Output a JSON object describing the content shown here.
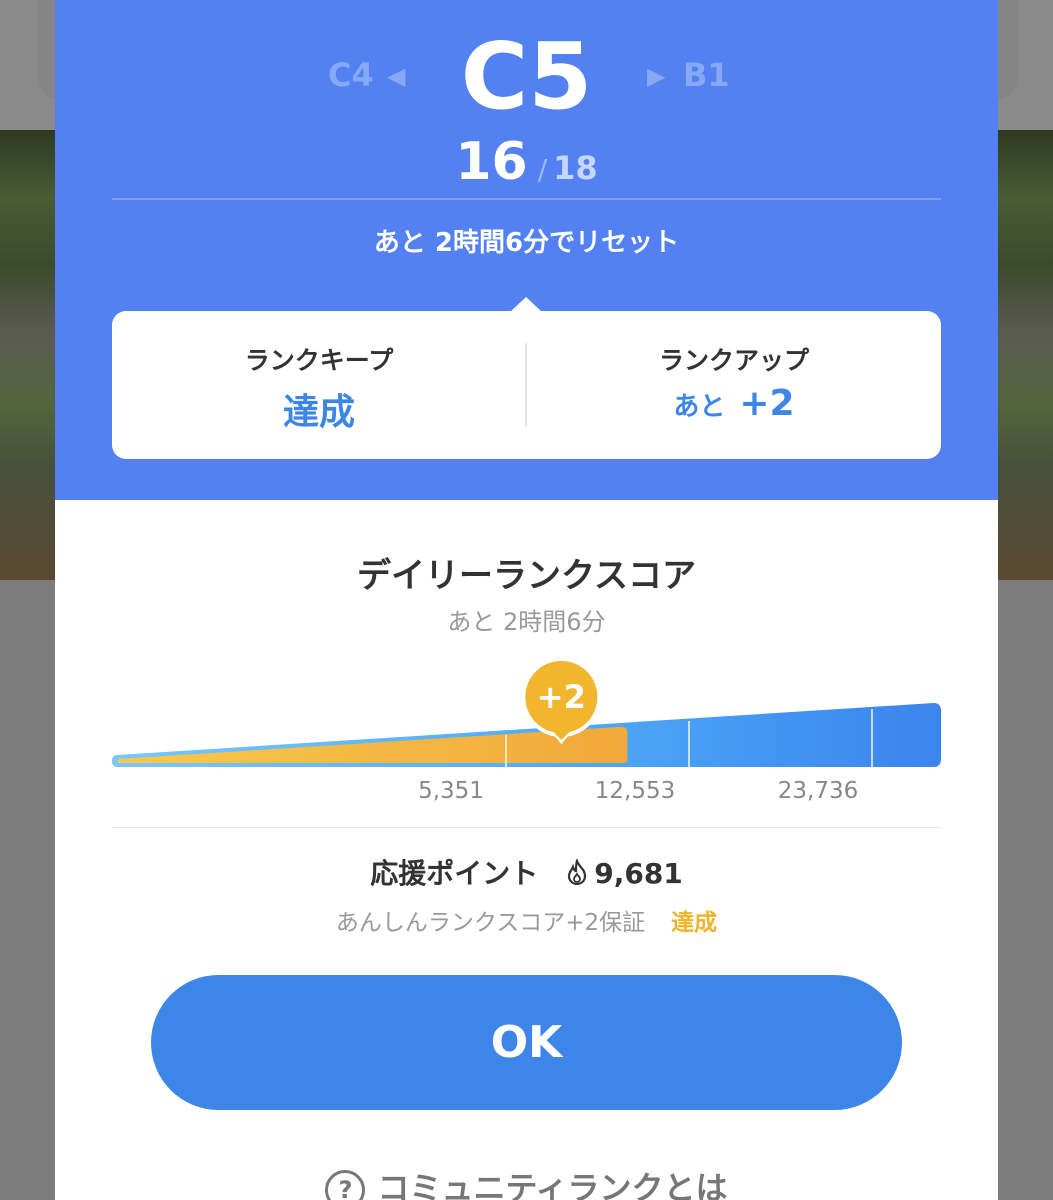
{
  "rank": {
    "previous": "C4",
    "current": "C5",
    "next": "B1",
    "current_count": "16",
    "separator": "/",
    "total_count": "18",
    "reset_text": "あと 2時間6分でリセット"
  },
  "status": {
    "keep_label": "ランクキープ",
    "keep_value": "達成",
    "up_label": "ランクアップ",
    "up_prefix": "あと",
    "up_value": "+2"
  },
  "score": {
    "title": "デイリーランクスコア",
    "subtitle": "あと 2時間6分",
    "bubble": "+2",
    "thresholds": [
      "5,351",
      "12,553",
      "23,736"
    ],
    "progress_fraction": 0.62
  },
  "points": {
    "label": "応援ポイント",
    "icon": "flame-icon",
    "value": "9,681",
    "guarantee_text": "あんしんランクスコア+2保証",
    "guarantee_status": "達成"
  },
  "ok_button": "OK",
  "help": {
    "icon": "?",
    "text": "コミュニティランクとは"
  },
  "colors": {
    "header_blue": "#5381f2",
    "accent_blue": "#3d86e8",
    "gold": "#f0b429"
  }
}
